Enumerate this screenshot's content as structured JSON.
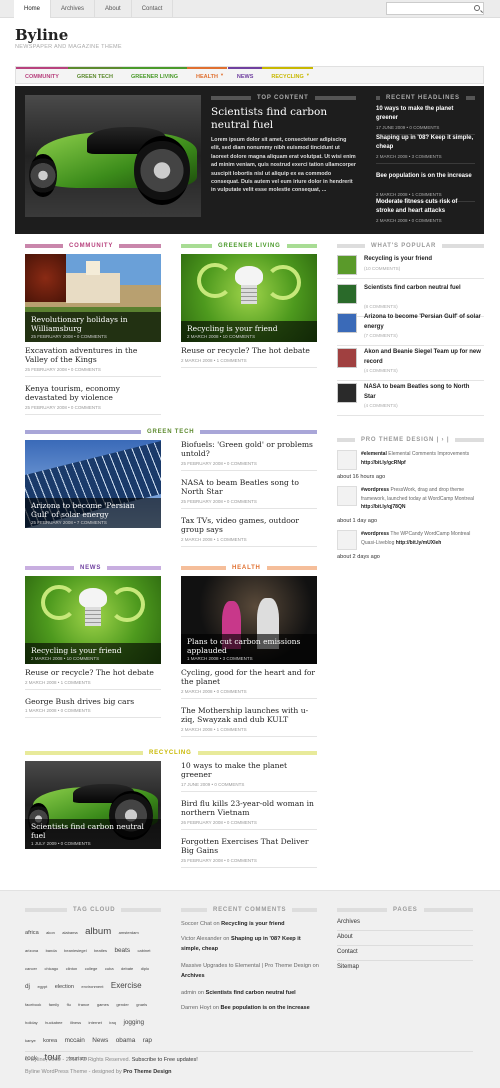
{
  "topnav": {
    "items": [
      "Home",
      "Archives",
      "About",
      "Contact"
    ]
  },
  "site": {
    "title": "Byline",
    "tagline": "NEWSPAPER AND MAGAZINE THEME"
  },
  "mainnav": {
    "items": [
      {
        "label": "COMMUNITY",
        "color": "#b8427e"
      },
      {
        "label": "GREEN TECH",
        "color": "#5c8a2e"
      },
      {
        "label": "GREENER LIVING",
        "color": "#4a9a2a"
      },
      {
        "label": "HEALTH",
        "color": "#e07030",
        "dropdown": true
      },
      {
        "label": "NEWS",
        "color": "#7040a0"
      },
      {
        "label": "RECYCLING",
        "color": "#c8b800",
        "dropdown": true
      }
    ]
  },
  "feature": {
    "section": "TOP CONTENT",
    "title": "Scientists find carbon neutral fuel",
    "excerpt": "Lorem ipsum dolor sit amet, consectetuer adipiscing elit, sed diam nonummy nibh euismod tincidunt ut laoreet dolore magna aliquam erat volutpat. Ut wisi enim ad minim veniam, quis nostrud exerci tation ullamcorper suscipit lobortis nisl ut aliquip ex ea commodo consequat. Duis autem vel eum iriure dolor in hendrerit in vulputate velit esse molestie consequat, ...",
    "recent_label": "RECENT HEADLINES",
    "recent": [
      {
        "title": "10 ways to make the planet greener",
        "meta": "17 JUNE 2009 • 0 COMMENTS"
      },
      {
        "title": "Shaping up in '08? Keep it simple, cheap",
        "meta": "2 MARCH 2008 • 3 COMMENTS"
      },
      {
        "title": "Bee population is on the increase",
        "meta": "2 MARCH 2008 • 1 COMMENTS"
      },
      {
        "title": "Moderate fitness cuts risk of stroke and heart attacks",
        "meta": "2 MARCH 2008 • 0 COMMENTS"
      }
    ]
  },
  "sections": {
    "community": {
      "label": "COMMUNITY",
      "color": "#c986ab",
      "feature": {
        "title": "Revolutionary holidays in Williamsburg",
        "meta": "25 FEBRUARY 2008 • 0 COMMENTS"
      },
      "posts": [
        {
          "title": "Excavation adventures in the Valley of the Kings",
          "meta": "25 FEBRUARY 2008 • 0 COMMENTS"
        },
        {
          "title": "Kenya tourism, economy devastated by violence",
          "meta": "25 FEBRUARY 2008 • 0 COMMENTS"
        }
      ]
    },
    "greener": {
      "label": "GREENER LIVING",
      "color": "#a8dc94",
      "feature": {
        "title": "Recycling is your friend",
        "meta": "2 MARCH 2008 • 10 COMMENTS"
      },
      "posts": [
        {
          "title": "Reuse or recycle? The hot debate",
          "meta": "2 MARCH 2008 • 1 COMMENTS"
        }
      ]
    },
    "greentech": {
      "label": "GREEN TECH",
      "color": "#a9a6d8",
      "feature": {
        "title": "Arizona to become 'Persian Gulf' of solar energy",
        "meta": "25 FEBRUARY 2008 • 7 COMMENTS"
      },
      "posts": [
        {
          "title": "Biofuels: 'Green gold' or problems untold?",
          "meta": "25 FEBRUARY 2008 • 0 COMMENTS"
        },
        {
          "title": "NASA to beam Beatles song to North Star",
          "meta": "25 FEBRUARY 2008 • 0 COMMENTS"
        },
        {
          "title": "Tax TVs, video games, outdoor group says",
          "meta": "2 MARCH 2008 • 1 COMMENTS"
        }
      ]
    },
    "news": {
      "label": "NEWS",
      "color": "#c8aee0",
      "feature": {
        "title": "Recycling is your friend",
        "meta": "2 MARCH 2008 • 10 COMMENTS"
      },
      "posts": [
        {
          "title": "Reuse or recycle? The hot debate",
          "meta": "2 MARCH 2008 • 1 COMMENTS"
        },
        {
          "title": "George Bush drives big cars",
          "meta": "1 MARCH 2008 • 0 COMMENTS"
        }
      ]
    },
    "health": {
      "label": "HEALTH",
      "color": "#f5be9a",
      "feature": {
        "title": "Plans to cut carbon emissions applauded",
        "meta": "1 MARCH 2008 • 3 COMMENTS"
      },
      "posts": [
        {
          "title": "Cycling, good for the heart and for the planet",
          "meta": "2 MARCH 2008 • 0 COMMENTS"
        },
        {
          "title": "The Mothership launches with u-ziq, Swayzak and dub KULT",
          "meta": "2 MARCH 2008 • 1 COMMENTS"
        }
      ]
    },
    "recycling": {
      "label": "RECYCLING",
      "color": "#e8ea9a",
      "feature": {
        "title": "Scientists find carbon neutral fuel",
        "meta": "1 JULY 2009 • 0 COMMENTS"
      },
      "posts": [
        {
          "title": "10 ways to make the planet greener",
          "meta": "17 JUNE 2009 • 0 COMMENTS"
        },
        {
          "title": "Bird flu kills 23-year-old woman in northern Vietnam",
          "meta": "26 FEBRUARY 2008 • 0 COMMENTS"
        },
        {
          "title": "Forgotten Exercises That Deliver Big Gains",
          "meta": "25 FEBRUARY 2008 • 0 COMMENTS"
        }
      ]
    }
  },
  "popular": {
    "label": "WHAT'S POPULAR",
    "items": [
      {
        "title": "Recycling is your friend",
        "meta": "(10 COMMENTS)"
      },
      {
        "title": "Scientists find carbon neutral fuel",
        "meta": "(8 COMMENTS)"
      },
      {
        "title": "Arizona to become 'Persian Gulf' of solar energy",
        "meta": "(7 COMMENTS)"
      },
      {
        "title": "Akon and Beanie Siegel Team up for new record",
        "meta": "(4 COMMENTS)"
      },
      {
        "title": "NASA to beam Beatles song to North Star",
        "meta": "(4 COMMENTS)"
      }
    ]
  },
  "twitter": {
    "label": "PRO THEME DESIGN | › |",
    "items": [
      {
        "tag": "#elemental",
        "text": "Elemental Comments Improvements",
        "link": "http://bit.ly/gcRNpf",
        "time": "about 16 hours ago"
      },
      {
        "tag": "#wordpress",
        "text": "PressWork, drag and drop theme framework, launched today at WordCamp Montreal",
        "link": "http://bit.ly/qj78QN",
        "time": "about 1 day ago"
      },
      {
        "tag": "#wordpress",
        "text": "The WPCandy WordCamp Montreal Quasi-Liveblog",
        "link": "http://bit.ly/mUXleh",
        "time": "about 2 days ago"
      }
    ]
  },
  "footer": {
    "tagcloud_label": "TAG CLOUD",
    "tags": [
      {
        "t": "africa",
        "s": 7
      },
      {
        "t": "akon",
        "s": 5
      },
      {
        "t": "alabama",
        "s": 5
      },
      {
        "t": "album",
        "s": 12
      },
      {
        "t": "amsterdam",
        "s": 5
      },
      {
        "t": "arizona",
        "s": 5
      },
      {
        "t": "banda",
        "s": 5
      },
      {
        "t": "beaniesiegel",
        "s": 5
      },
      {
        "t": "beatles",
        "s": 5
      },
      {
        "t": "beats",
        "s": 8
      },
      {
        "t": "cabinet",
        "s": 5
      },
      {
        "t": "cancer",
        "s": 5
      },
      {
        "t": "chicago",
        "s": 5
      },
      {
        "t": "clinton",
        "s": 5
      },
      {
        "t": "college",
        "s": 5
      },
      {
        "t": "cuba",
        "s": 5
      },
      {
        "t": "debate",
        "s": 5
      },
      {
        "t": "diplo",
        "s": 5
      },
      {
        "t": "dj",
        "s": 8
      },
      {
        "t": "egypt",
        "s": 5
      },
      {
        "t": "election",
        "s": 7
      },
      {
        "t": "environment",
        "s": 5
      },
      {
        "t": "Exercise",
        "s": 10
      },
      {
        "t": "facebook",
        "s": 5
      },
      {
        "t": "family",
        "s": 5
      },
      {
        "t": "flu",
        "s": 5
      },
      {
        "t": "france",
        "s": 5
      },
      {
        "t": "games",
        "s": 5
      },
      {
        "t": "gender",
        "s": 5
      },
      {
        "t": "gnarls",
        "s": 5
      },
      {
        "t": "holiday",
        "s": 5
      },
      {
        "t": "huckabee",
        "s": 5
      },
      {
        "t": "illness",
        "s": 5
      },
      {
        "t": "internet",
        "s": 5
      },
      {
        "t": "iraq",
        "s": 5
      },
      {
        "t": "jogging",
        "s": 8
      },
      {
        "t": "kanye",
        "s": 5
      },
      {
        "t": "korea",
        "s": 7
      },
      {
        "t": "mccain",
        "s": 8
      },
      {
        "t": "News",
        "s": 8
      },
      {
        "t": "obama",
        "s": 8
      },
      {
        "t": "rap",
        "s": 8
      },
      {
        "t": "rock",
        "s": 8
      },
      {
        "t": "tour",
        "s": 12
      },
      {
        "t": "tourism",
        "s": 7
      }
    ],
    "comments_label": "RECENT COMMENTS",
    "comments": [
      {
        "who": "Soccer Chat",
        "on": "Recycling is your friend"
      },
      {
        "who": "Victor Alexander",
        "on": "Shaping up in '08? Keep it simple, cheap"
      },
      {
        "who": "Massive Upgrades to Elemental | Pro Theme Design",
        "on": "Archives"
      },
      {
        "who": "admin",
        "on": "Scientists find carbon neutral fuel"
      },
      {
        "who": "Darren Hoyt",
        "on": "Bee population is on the increase"
      }
    ],
    "pages_label": "PAGES",
    "pages": [
      "Archives",
      "About",
      "Contact",
      "Sitemap"
    ],
    "copyright": "© Byline, 2009 - 2011. All Rights Reserved.",
    "subscribe": "Subscribe to Free updates!",
    "credit_prefix": "Byline WordPress Theme - designed by",
    "credit_link": "Pro Theme Design"
  }
}
